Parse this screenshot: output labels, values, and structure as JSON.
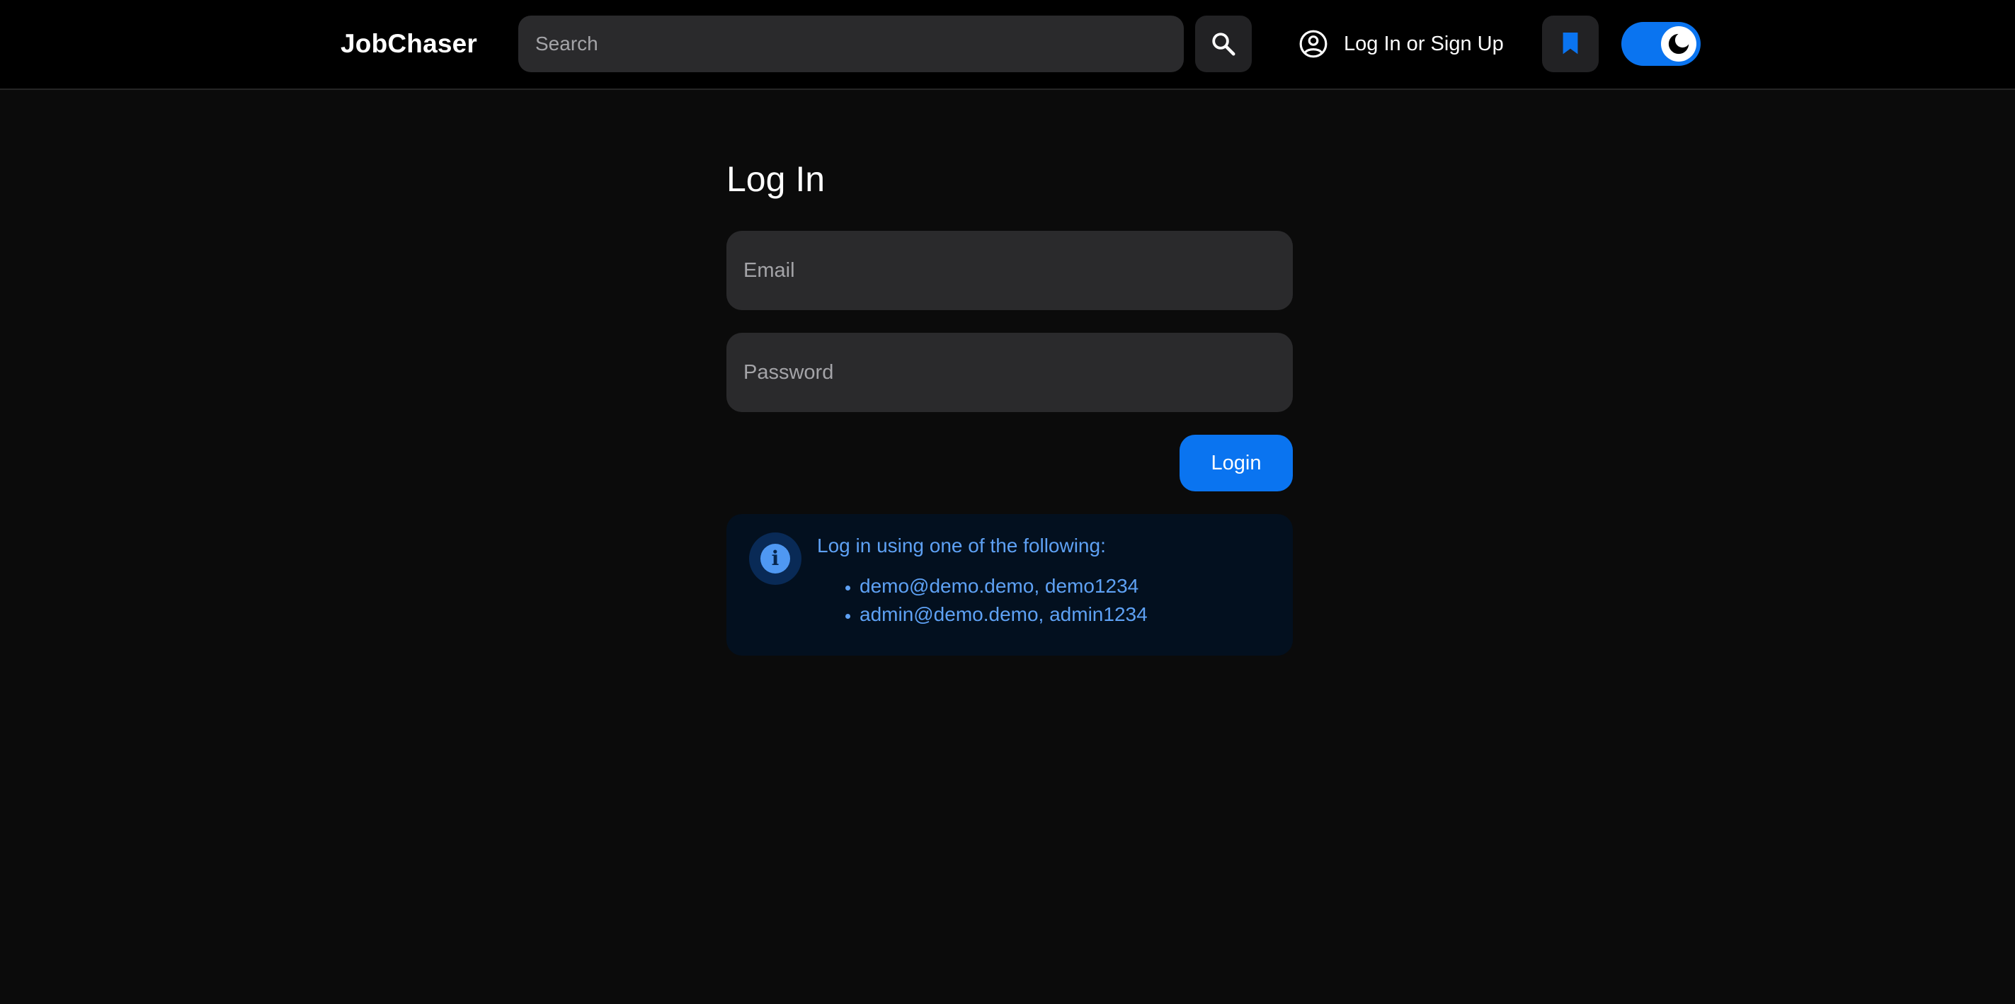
{
  "navbar": {
    "brand": "JobChaser",
    "search": {
      "placeholder": "Search",
      "value": ""
    },
    "search_button_icon": "search-icon",
    "login_link_icon": "user-circle-icon",
    "login_link_label": "Log In or Sign Up",
    "bookmark_icon": "bookmark-icon",
    "theme_toggle": {
      "icon": "moon-icon",
      "state": "on",
      "mode": "dark"
    }
  },
  "login_form": {
    "title": "Log In",
    "email": {
      "placeholder": "Email",
      "value": ""
    },
    "password": {
      "placeholder": "Password",
      "value": ""
    },
    "submit_label": "Login"
  },
  "info_alert": {
    "icon": "info-icon",
    "icon_glyph": "i",
    "heading": "Log in using one of the following:",
    "items": [
      "demo@demo.demo, demo1234",
      "admin@demo.demo, admin1234"
    ]
  },
  "colors": {
    "accent": "#0a74f0",
    "background": "#0b0b0b",
    "navbar": "#000000",
    "input_bg": "#2a2a2c",
    "info_bg": "#03101f",
    "info_text": "#5ea1f4"
  }
}
